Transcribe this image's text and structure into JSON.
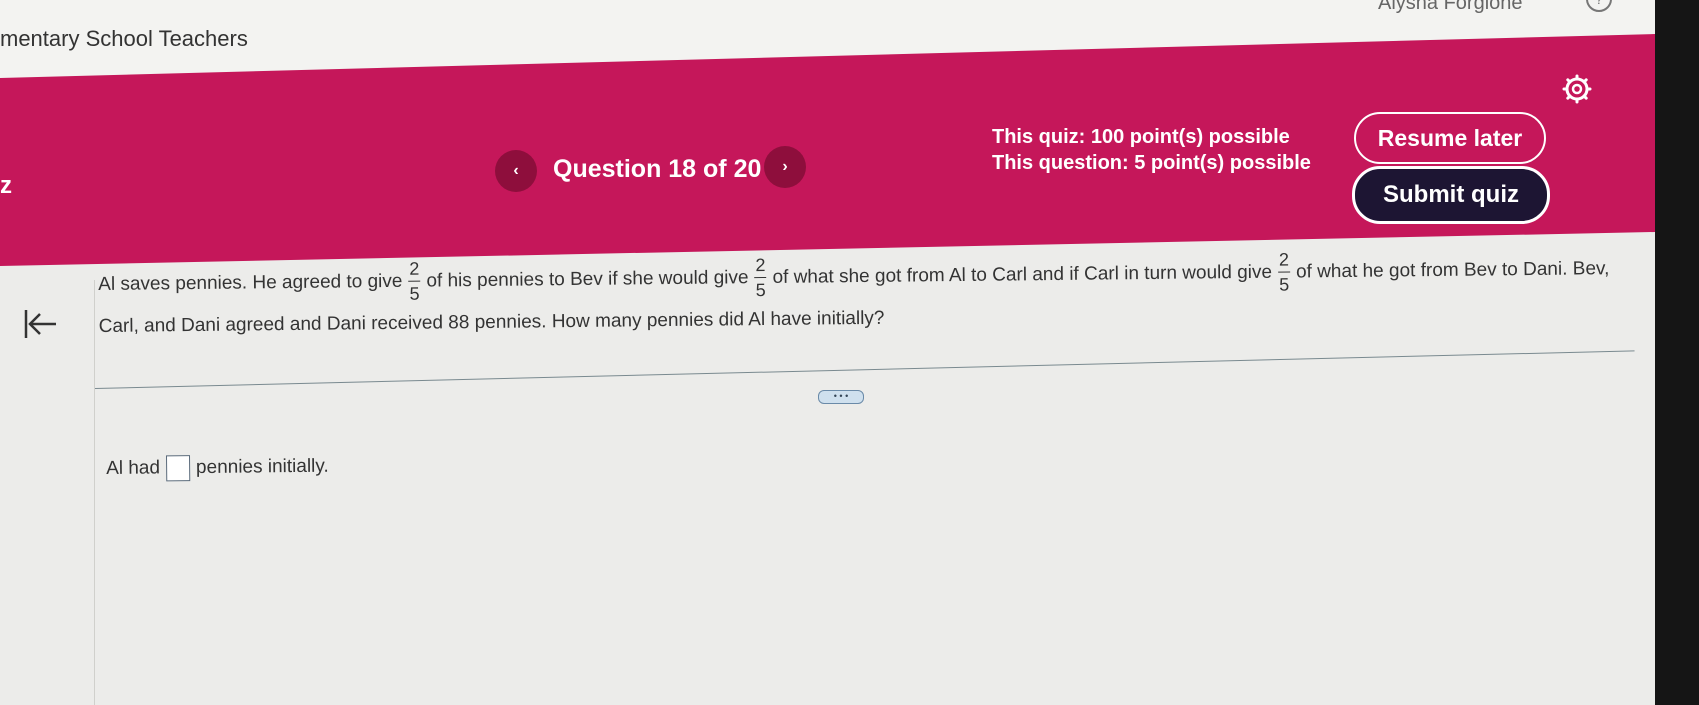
{
  "topbar": {
    "course_title": "mentary School Teachers",
    "user_name": "Alysha Forgione"
  },
  "header": {
    "left_label": "z",
    "prev_label": "‹",
    "next_label": "›",
    "question_counter": "Question 18 of 20",
    "points_quiz": "This quiz: 100 point(s) possible",
    "points_question": "This question: 5 point(s) possible",
    "resume_label": "Resume later",
    "submit_label": "Submit quiz"
  },
  "question": {
    "t1": "Al saves pennies. He agreed to give",
    "f1_num": "2",
    "f1_den": "5",
    "t2": "of his pennies to Bev if she would give",
    "f2_num": "2",
    "f2_den": "5",
    "t3": "of what she got from Al to Carl and if Carl in turn would give",
    "f3_num": "2",
    "f3_den": "5",
    "t4": "of what he got from Bev to Dani. Bev,",
    "line2": "Carl, and Dani agreed and Dani received 88 pennies. How many pennies did Al have initially?"
  },
  "more_label": "• • •",
  "answer": {
    "prefix": "Al had",
    "suffix": "pennies initially."
  },
  "colors": {
    "header_bg": "#c5175a",
    "submit_bg": "#1d1533"
  },
  "icons": [
    "help-icon",
    "settings-icon",
    "back-arrow-icon",
    "chevron-left-icon",
    "chevron-right-icon"
  ]
}
